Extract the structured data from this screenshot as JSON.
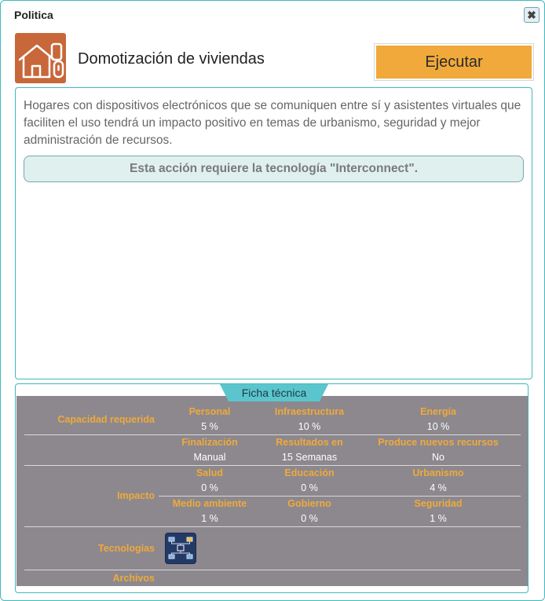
{
  "window": {
    "title": "Politica",
    "close_icon": "close-icon"
  },
  "policy": {
    "icon": "home-devices-icon",
    "title": "Domotización de viviendas",
    "execute_label": "Ejecutar",
    "description": "Hogares con dispositivos electrónicos que se comuniquen entre sí y asistentes virtuales que faciliten el uso tendrá un impacto positivo en temas de urbanismo, seguridad y mejor administración de recursos.",
    "requirement": "Esta acción requiere la tecnología \"Interconnect\"."
  },
  "ficha": {
    "tab_label": "Ficha técnica",
    "capacidad": {
      "row_label": "Capacidad requerida",
      "cols": [
        {
          "label": "Personal",
          "value": "5 %"
        },
        {
          "label": "Infraestructura",
          "value": "10 %"
        },
        {
          "label": "Energía",
          "value": "10 %"
        }
      ]
    },
    "info": {
      "cols": [
        {
          "label": "Finalización",
          "value": "Manual"
        },
        {
          "label": "Resultados en",
          "value": "15 Semanas"
        },
        {
          "label": "Produce nuevos recursos",
          "value": "No"
        }
      ]
    },
    "impacto": {
      "row_label": "Impacto",
      "row1": [
        {
          "label": "Salud",
          "value": "0 %"
        },
        {
          "label": "Educación",
          "value": "0 %"
        },
        {
          "label": "Urbanismo",
          "value": "4 %"
        }
      ],
      "row2": [
        {
          "label": "Medio ambiente",
          "value": "1 %"
        },
        {
          "label": "Gobierno",
          "value": "0 %"
        },
        {
          "label": "Seguridad",
          "value": "1 %"
        }
      ]
    },
    "tecnologias": {
      "row_label": "Tecnologías",
      "icon": "network-tech-icon"
    },
    "archivos": {
      "row_label": "Archivos"
    }
  },
  "colors": {
    "accent": "#f0a93a",
    "border": "#3fb8c0",
    "panel": "#8c888e",
    "tab": "#5bc5cd",
    "icon_bg": "#c8673a"
  }
}
